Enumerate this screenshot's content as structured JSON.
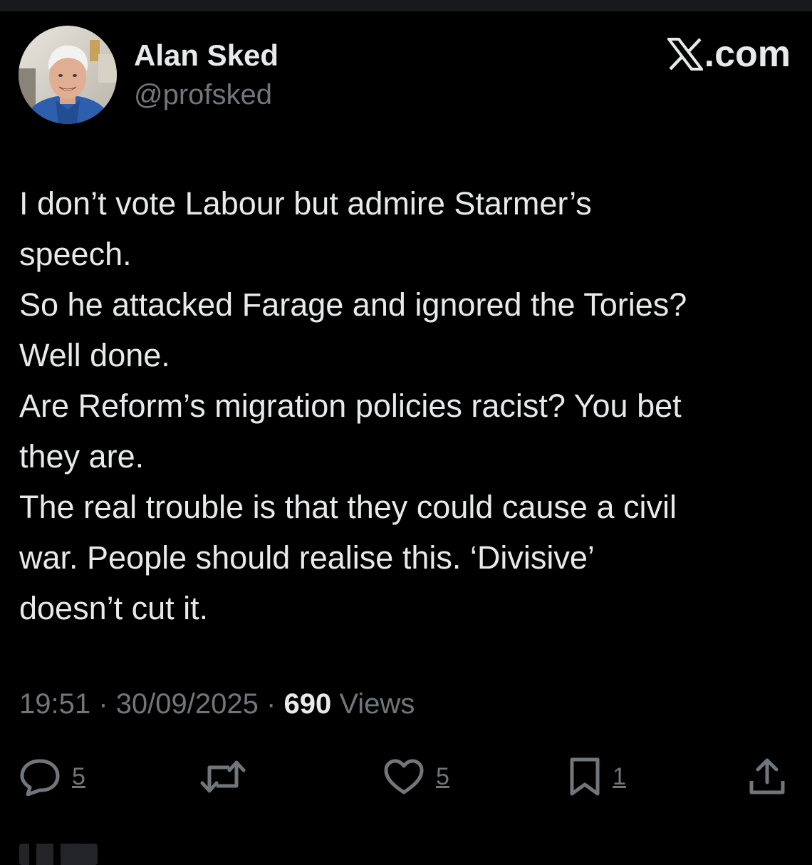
{
  "author": {
    "display_name": "Alan Sked",
    "handle": "@profsked"
  },
  "brand": {
    "text": ".com",
    "icon": "x-logo-icon"
  },
  "tweet": {
    "lines": [
      "I don’t vote Labour but admire Starmer’s",
      "speech.",
      "So he attacked Farage and ignored the Tories?",
      "Well done.",
      "Are Reform’s migration policies racist? You bet",
      "they are.",
      "The real trouble is that they could cause a civil",
      "war. People should realise this. ‘Divisive’",
      "doesn’t cut it."
    ]
  },
  "meta": {
    "time": "19:51",
    "date": "30/09/2025",
    "views_count": "690",
    "views_label": "Views",
    "separator": "·"
  },
  "actions": {
    "reply_count": "5",
    "like_count": "5",
    "bookmark_count": "1"
  },
  "colors": {
    "background": "#000000",
    "text": "#e7e9ea",
    "muted": "#71767b"
  }
}
